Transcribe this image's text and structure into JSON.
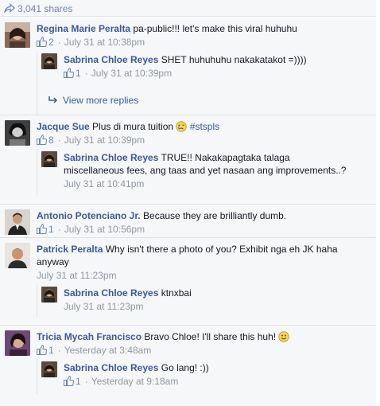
{
  "shares": {
    "label": "3,041 shares"
  },
  "comments": [
    {
      "author": "Regina Marie Peralta",
      "text": "pa-public!!! let's make this viral huhuhu",
      "likes": "2",
      "time": "July 31 at 10:38pm",
      "replies": [
        {
          "author": "Sabrina Chloe Reyes",
          "text": "SHET huhuhuhu nakakatakot =))))",
          "likes": "1",
          "time": "July 31 at 10:39pm"
        }
      ],
      "view_more": "View more replies"
    },
    {
      "author": "Jacque Sue",
      "text": "Plus di mura tuition",
      "hashtag": "#stspls",
      "likes": "8",
      "time": "July 31 at 10:39pm",
      "replies": [
        {
          "author": "Sabrina Chloe Reyes",
          "text_line1": "TRUE!! Nakakapagtaka talaga",
          "text_line2": "miscellaneous fees, ang taas and yet nasaan ang improvements..?",
          "time": "July 31 at 10:41pm"
        }
      ]
    },
    {
      "author": "Antonio Potenciano Jr.",
      "text": "Because they are brilliantly dumb.",
      "likes": "1",
      "time": "July 31 at 10:56pm"
    },
    {
      "author": "Patrick Peralta",
      "text_line1": "Why isn't there a photo of you? Exhibit nga eh JK haha",
      "text_line2": "anyway",
      "time": "July 31 at 11:23pm",
      "replies": [
        {
          "author": "Sabrina Chloe Reyes",
          "text": "ktnxbai",
          "time": "July 31 at 11:23pm"
        }
      ]
    },
    {
      "author": "Tricia Mycah Francisco",
      "text": "Bravo Chloe! I'll share this huh!",
      "likes": "1",
      "time": "Yesterday at 3:48am",
      "replies": [
        {
          "author": "Sabrina Chloe Reyes",
          "text": "Go lang! :))",
          "likes": "1",
          "time": "Yesterday at 9:18am"
        }
      ]
    }
  ],
  "colors": {
    "link": "#3b5998",
    "meta": "#9197a3",
    "background": "#f6f7f8",
    "border": "#e1e2e3"
  },
  "icons": {
    "share": "share-arrow-icon",
    "like": "thumbs-up-icon",
    "reply": "reply-arrow-icon",
    "emoji_cry": "crying-face-emoji",
    "emoji_smile": "smile-emoji"
  }
}
